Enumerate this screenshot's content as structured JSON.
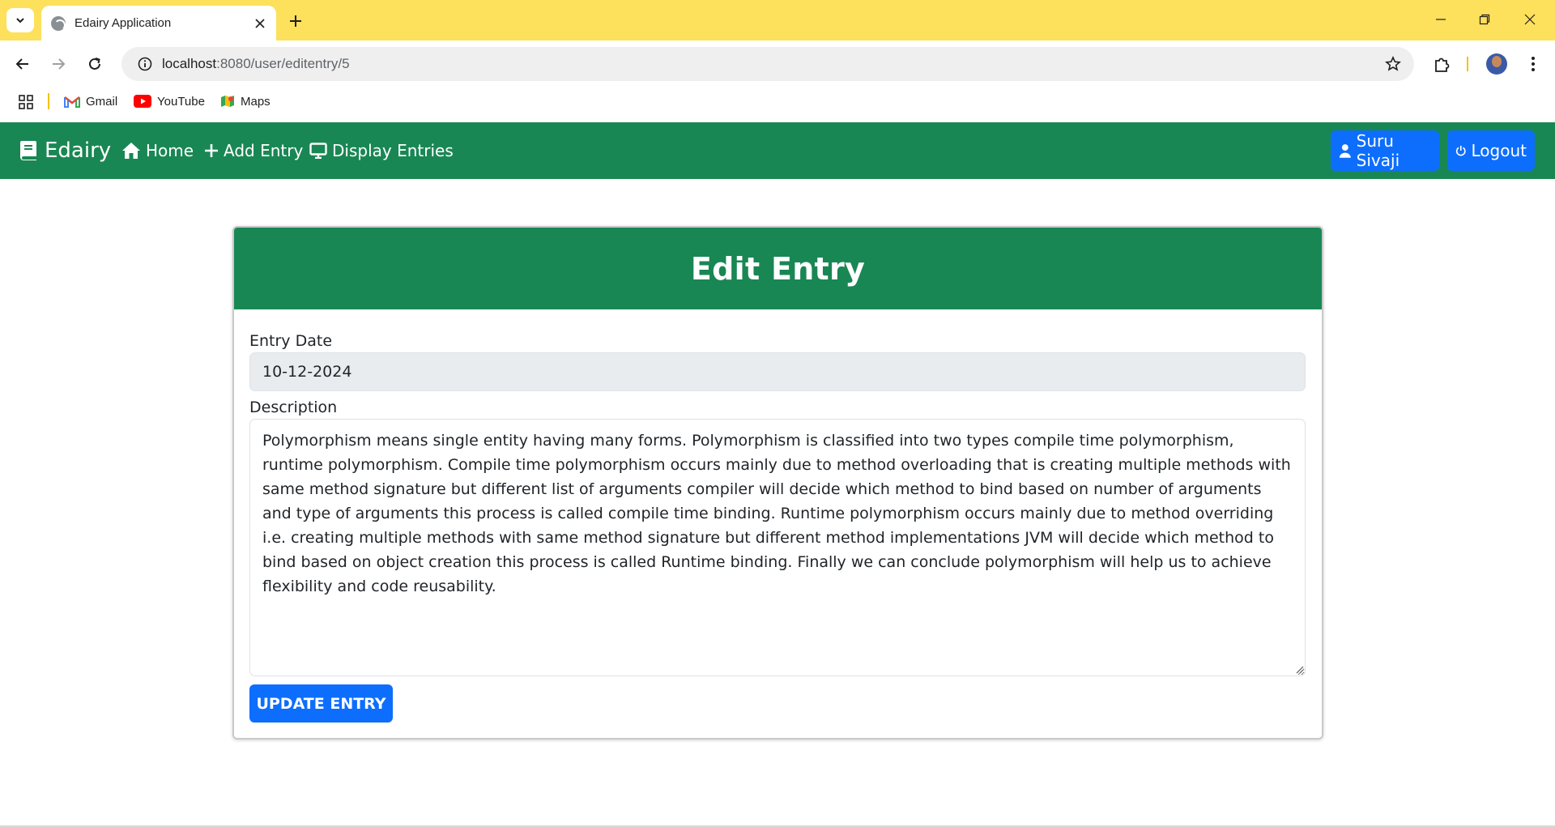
{
  "browser": {
    "tab_title": "Edairy Application",
    "url_host": "localhost",
    "url_path": ":8080/user/editentry/5",
    "bookmarks": [
      {
        "label": "Gmail"
      },
      {
        "label": "YouTube"
      },
      {
        "label": "Maps"
      }
    ]
  },
  "app_nav": {
    "brand": "Edairy",
    "links": [
      "Home",
      "Add Entry",
      "Display Entries"
    ],
    "user_button": "Suru Sivaji",
    "logout_button": "Logout",
    "colors": {
      "navbar": "#198754",
      "button": "#0d6efd"
    }
  },
  "form": {
    "title": "Edit Entry",
    "date_label": "Entry Date",
    "date_value": "10-12-2024",
    "description_label": "Description",
    "description_value": "Polymorphism means single entity having many forms. Polymorphism is classified into two types compile time polymorphism, runtime polymorphism. Compile time polymorphism occurs mainly due to method overloading that is creating multiple methods with same method signature but different list of arguments compiler will decide which method to bind based on number of arguments and type of arguments this process is called compile time binding. Runtime polymorphism occurs mainly due to method overriding i.e. creating multiple methods with same method signature but different method implementations JVM will decide which method to bind based on object creation this process is called Runtime binding. Finally we can conclude polymorphism will help us to achieve flexibility and code reusability.",
    "submit_label": "UPDATE ENTRY"
  }
}
